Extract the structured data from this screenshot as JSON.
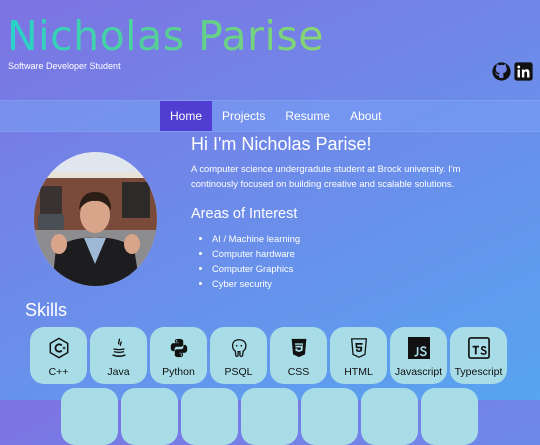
{
  "header": {
    "title": "Nicholas Parise",
    "subtitle": "Software Developer Student"
  },
  "social": [
    {
      "icon": "github-icon"
    },
    {
      "icon": "linkedin-icon"
    }
  ],
  "nav": {
    "items": [
      {
        "label": "Home",
        "active": true
      },
      {
        "label": "Projects",
        "active": false
      },
      {
        "label": "Resume",
        "active": false
      },
      {
        "label": "About",
        "active": false
      }
    ]
  },
  "intro": {
    "heading": "Hi I'm Nicholas Parise!",
    "text": "A computer science undergradute student at Brock university. I'm continously focused on building creative and scalable solutions."
  },
  "interests": {
    "heading": "Areas of Interest",
    "items": [
      "AI / Machine learning",
      "Computer hardware",
      "Computer Graphics",
      "Cyber security"
    ]
  },
  "skills": {
    "heading": "Skills",
    "items": [
      {
        "label": "C++",
        "icon": "cpp-icon"
      },
      {
        "label": "Java",
        "icon": "java-icon"
      },
      {
        "label": "Python",
        "icon": "python-icon"
      },
      {
        "label": "PSQL",
        "icon": "postgresql-icon"
      },
      {
        "label": "CSS",
        "icon": "css3-icon"
      },
      {
        "label": "HTML",
        "icon": "html5-icon"
      },
      {
        "label": "Javascript",
        "icon": "javascript-icon"
      },
      {
        "label": "Typescript",
        "icon": "typescript-icon"
      }
    ]
  },
  "colors": {
    "active_nav": "#4f3ed0",
    "skill_card": "#a8dce6",
    "title_gradient_start": "#27d3c7",
    "title_gradient_end": "#8bd66f"
  }
}
